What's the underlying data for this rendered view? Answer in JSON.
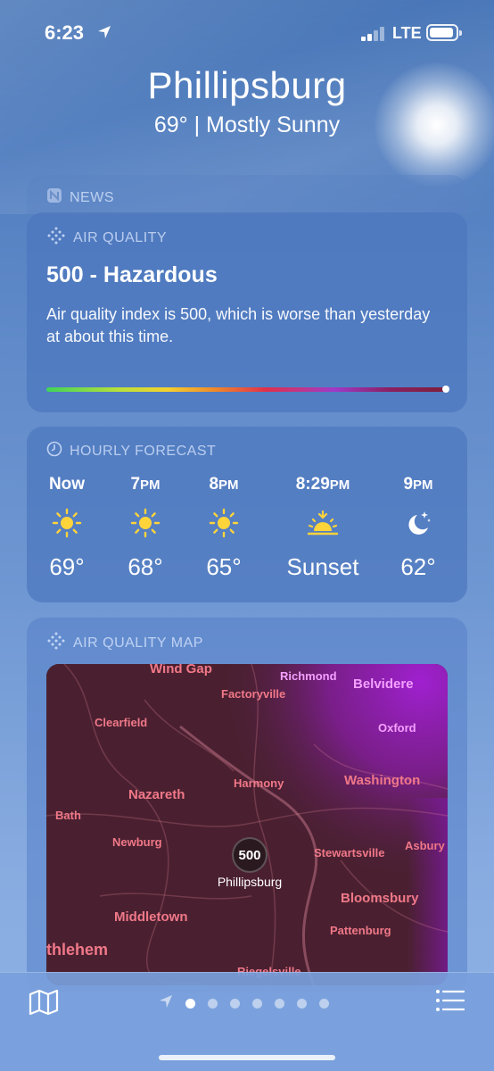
{
  "status": {
    "time": "6:23",
    "carrier": "LTE"
  },
  "header": {
    "city": "Phillipsburg",
    "summary": "69°  |  Mostly Sunny"
  },
  "news": {
    "label": "NEWS"
  },
  "air_quality": {
    "label": "AIR QUALITY",
    "value": "500 - Hazardous",
    "description": "Air quality index is 500, which is worse than yesterday at about this time.",
    "level_fraction": 1.0
  },
  "hourly": {
    "label": "HOURLY FORECAST",
    "items": [
      {
        "time": "Now",
        "suffix": "",
        "icon": "sun-icon",
        "temp": "69°"
      },
      {
        "time": "7",
        "suffix": "PM",
        "icon": "sun-icon",
        "temp": "68°"
      },
      {
        "time": "8",
        "suffix": "PM",
        "icon": "sun-icon",
        "temp": "65°"
      },
      {
        "time": "8:29",
        "suffix": "PM",
        "icon": "sunset-icon",
        "temp": "Sunset"
      },
      {
        "time": "9",
        "suffix": "PM",
        "icon": "moon-stars-icon",
        "temp": "62°"
      }
    ]
  },
  "aq_map": {
    "label": "AIR QUALITY MAP",
    "marker_value": "500",
    "marker_label": "Phillipsburg",
    "towns": [
      "Wind Gap",
      "Richmond",
      "Belvidere",
      "Factoryville",
      "Clearfield",
      "Oxford",
      "Harmony",
      "Washington",
      "Nazareth",
      "Bath",
      "Newburg",
      "Stewartsville",
      "Asbury",
      "Bloomsbury",
      "Middletown",
      "Pattenburg",
      "thlehem",
      "Riegelsville"
    ]
  },
  "colors": {
    "hazardous": "#7e1f3a",
    "sun": "#ffd43b",
    "map_bg": "#4a2030"
  },
  "pager": {
    "count": 7,
    "active_index": 0
  }
}
